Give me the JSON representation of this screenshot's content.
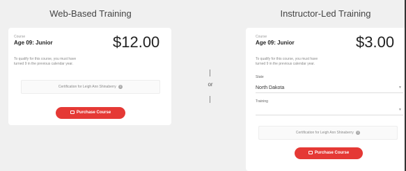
{
  "left": {
    "title": "Web-Based Training",
    "course_caption": "Course",
    "course_name": "Age 09: Junior",
    "price": "$12.00",
    "qualify_text": "To qualify for this course, you must have turned 9 in the previous calendar year.",
    "certification_text": "Certification for Leigh Ann Shinaberry",
    "purchase_label": "Purchase Course"
  },
  "divider": {
    "or_label": "or"
  },
  "right": {
    "title": "Instructor-Led Training",
    "course_caption": "Course",
    "course_name": "Age 09: Junior",
    "price": "$3.00",
    "qualify_text": "To qualify for this course, you must have turned 9 in the previous calendar year.",
    "state_label": "State",
    "state_value": "North Dakota",
    "training_label": "Training",
    "training_value": "",
    "certification_text": "Certification for Leigh Ann Shinaberry",
    "purchase_label": "Purchase Course"
  },
  "colors": {
    "accent": "#e53935",
    "background": "#f0f0f0",
    "card": "#ffffff"
  },
  "icons": {
    "info": "info-icon",
    "cart": "cart-icon",
    "chevron": "chevron-down-icon"
  }
}
